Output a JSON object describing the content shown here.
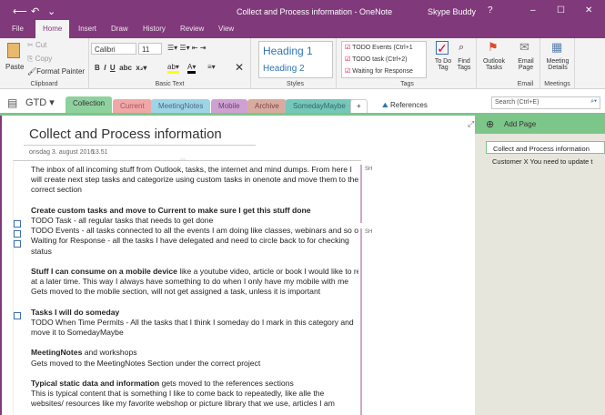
{
  "window": {
    "title": "Collect and Process information - OneNote",
    "user": "Skype Buddy",
    "help": "?",
    "minimize": "–",
    "maximize": "☐",
    "close": "✕",
    "back": "⟵",
    "undo": "↶",
    "qat": "⌄"
  },
  "menu": [
    "File",
    "Home",
    "Insert",
    "Draw",
    "History",
    "Review",
    "View"
  ],
  "ribbon": {
    "clipboard": {
      "label": "Clipboard",
      "paste": "Paste",
      "cut": "Cut",
      "copy": "Copy",
      "format_painter": "Format Painter"
    },
    "basic_text": {
      "label": "Basic Text",
      "font": "Calibri",
      "size": "11"
    },
    "styles": {
      "label": "Styles",
      "h1": "Heading 1",
      "h2": "Heading 2"
    },
    "tags": {
      "label": "Tags",
      "items": [
        "TODO Events (Ctrl+1",
        "TODO task (Ctrl+2)",
        "Waiting for Response"
      ],
      "todo": "To Do Tag",
      "find": "Find Tags",
      "outlook": "Outlook Tasks"
    },
    "email": {
      "label": "Email",
      "button": "Email Page"
    },
    "meetings": {
      "label": "Meetings",
      "button": "Meeting Details"
    }
  },
  "notebook": {
    "name": "GTD",
    "sections": [
      "Collection",
      "Current",
      "MeetingNotes",
      "Mobile",
      "Archive",
      "SomedayMaybe",
      "+"
    ],
    "section_colors": [
      "#8fd19e",
      "#f0a7a7",
      "#9dd4e8",
      "#cfa1d3",
      "#d9aba0",
      "#74c7b9",
      "#ffffff"
    ],
    "references": "References",
    "search_placeholder": "Search (Ctrl+E)"
  },
  "page": {
    "title": "Collect and Process information",
    "date": "onsdag 3. august 2016",
    "time": "13.51",
    "initials": [
      "SH",
      "SH"
    ],
    "lines": [
      {
        "bold": "",
        "text": "The inbox of all incoming stuff from Outlook, tasks, the internet and mind dumps. From here I"
      },
      {
        "bold": "",
        "text": "will create next step tasks and categorize using custom tasks in onenote and move them to the"
      },
      {
        "bold": "",
        "text": "correct section"
      },
      {
        "bold": "",
        "text": ""
      },
      {
        "bold": "Create custom tasks and move to Current to make sure I get this stuff done",
        "text": ""
      },
      {
        "bold": "",
        "text": "TODO Task - all regular tasks that needs to get done"
      },
      {
        "bold": "",
        "text": "TODO Events - all tasks connected to all the events I am doing like classes, webinars and so on"
      },
      {
        "bold": "",
        "text": "Waiting for Response - all the tasks I have delegated and need to circle back to for checking"
      },
      {
        "bold": "",
        "text": "status"
      },
      {
        "bold": "",
        "text": ""
      },
      {
        "bold": "Stuff I can consume on a mobile device",
        "text": " like a youtube video, article or book I would like to read"
      },
      {
        "bold": "",
        "text": "at a later time. This way I always have something to do when I only have my mobile with me"
      },
      {
        "bold": "",
        "text": "Gets moved to the mobile section, will not get assigned a task, unless it is important"
      },
      {
        "bold": "",
        "text": ""
      },
      {
        "bold": "Tasks I will do someday",
        "text": ""
      },
      {
        "bold": "",
        "text": "TODO When Time Permits - All the tasks that I think I someday do I mark in this category and"
      },
      {
        "bold": "",
        "text": "move it to SomedayMaybe"
      },
      {
        "bold": "",
        "text": ""
      },
      {
        "bold": "MeetingNotes",
        "text": " and workshops"
      },
      {
        "bold": "",
        "text": "Gets moved to the MeetingNotes Section under the correct project"
      },
      {
        "bold": "",
        "text": ""
      },
      {
        "bold": "Typical static data and information",
        "text": " gets moved to the references sections"
      },
      {
        "bold": "",
        "text": "This is typical content that is something I like to come back to repeatedly, like alle the"
      },
      {
        "bold": "",
        "text": "websites/ resources like my favorite webshop or picture library that we use, articles I am"
      }
    ]
  },
  "pages_panel": {
    "add_page": "Add Page",
    "pages": [
      "Collect and Process information",
      "Customer X You need to update t"
    ]
  }
}
